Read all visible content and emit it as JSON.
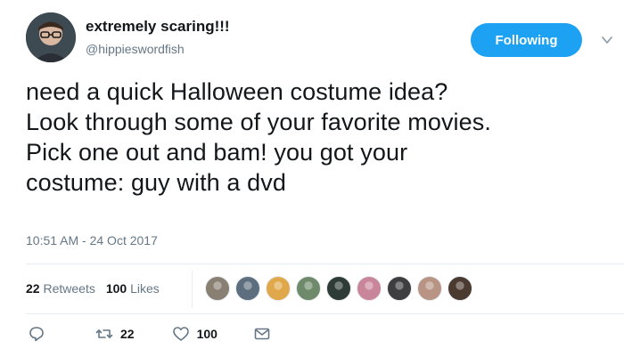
{
  "author": {
    "display_name": "extremely scaring!!!",
    "username": "@hippieswordfish"
  },
  "follow_button": {
    "label": "Following"
  },
  "tweet": {
    "text": "need a quick  Halloween costume idea?\nLook through some of your favorite movies.\nPick one out and bam! you got your\ncostume: guy with a dvd",
    "timestamp": "10:51 AM - 24 Oct 2017"
  },
  "stats": {
    "retweets_count": "22",
    "retweets_label": "Retweets",
    "likes_count": "100",
    "likes_label": "Likes"
  },
  "liker_avatars": [
    {
      "color": "#8a7f73"
    },
    {
      "color": "#5d6f7e"
    },
    {
      "color": "#e0a84a"
    },
    {
      "color": "#6f8a6a"
    },
    {
      "color": "#2e3b36"
    },
    {
      "color": "#c9869b"
    },
    {
      "color": "#3e3d3f"
    },
    {
      "color": "#b99384"
    },
    {
      "color": "#4b3a2f"
    }
  ],
  "actions": {
    "reply_icon": "reply-icon",
    "retweet_icon": "retweet-icon",
    "retweet_count": "22",
    "like_icon": "heart-icon",
    "like_count": "100",
    "dm_icon": "envelope-icon"
  },
  "colors": {
    "accent": "#1da1f2",
    "secondary_text": "#657786",
    "divider": "#e6ecf0"
  }
}
